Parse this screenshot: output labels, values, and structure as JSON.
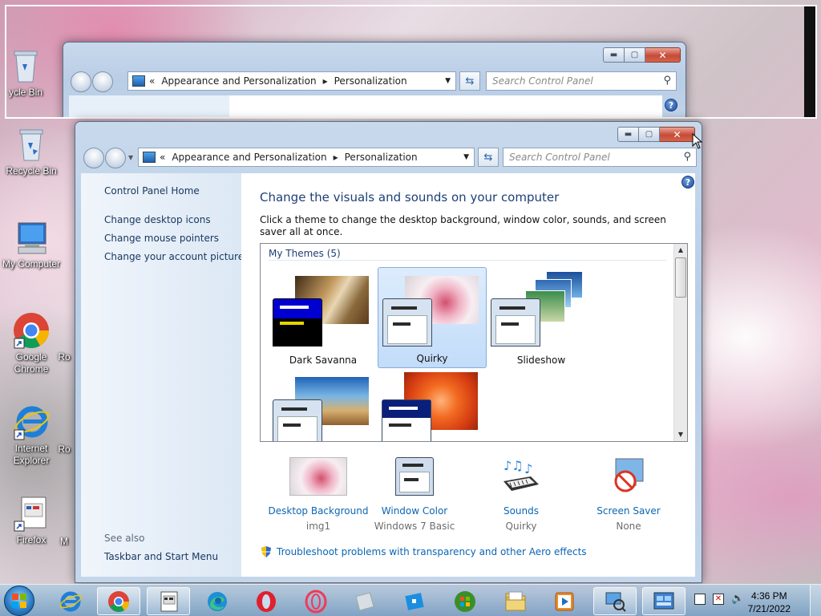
{
  "desktop": {
    "icons": [
      {
        "label": "Recycle Bin"
      },
      {
        "label": "My Computer"
      },
      {
        "label": "Google Chrome"
      },
      {
        "label": "Internet Explorer"
      },
      {
        "label": "Firefox"
      }
    ],
    "back_window_partial_label": "ycle Bin",
    "partial_labels": [
      "Ro",
      "Ro",
      "M"
    ]
  },
  "back_window": {
    "breadcrumb_root_chevron": "«",
    "crumb1": "Appearance and Personalization",
    "crumb2": "Personalization",
    "search_placeholder": "Search Control Panel",
    "partial_text": "Control Panel Home"
  },
  "window": {
    "breadcrumb_root_chevron": "«",
    "crumb1": "Appearance and Personalization",
    "crumb_sep": "▸",
    "crumb2": "Personalization",
    "search_placeholder": "Search Control Panel",
    "sidebar": {
      "home": "Control Panel Home",
      "links": [
        "Change desktop icons",
        "Change mouse pointers",
        "Change your account picture"
      ],
      "see_also_heading": "See also",
      "see_also_links": [
        "Taskbar and Start Menu"
      ]
    },
    "heading": "Change the visuals and sounds on your computer",
    "description": "Click a theme to change the desktop background, window color, sounds, and screen saver all at once.",
    "themes_group": "My Themes (5)",
    "themes": [
      {
        "name": "Dark Savanna"
      },
      {
        "name": "Quirky"
      },
      {
        "name": "Slideshow"
      }
    ],
    "bottom": [
      {
        "label": "Desktop Background",
        "value": "img1"
      },
      {
        "label": "Window Color",
        "value": "Windows 7 Basic"
      },
      {
        "label": "Sounds",
        "value": "Quirky"
      },
      {
        "label": "Screen Saver",
        "value": "None"
      }
    ],
    "troubleshoot": "Troubleshoot problems with transparency and other Aero effects"
  },
  "taskbar": {
    "time": "4:36 PM",
    "date": "7/21/2022"
  },
  "colors": {
    "link": "#0b66b4",
    "heading": "#1e3f75",
    "close_button": "#c84a36"
  }
}
